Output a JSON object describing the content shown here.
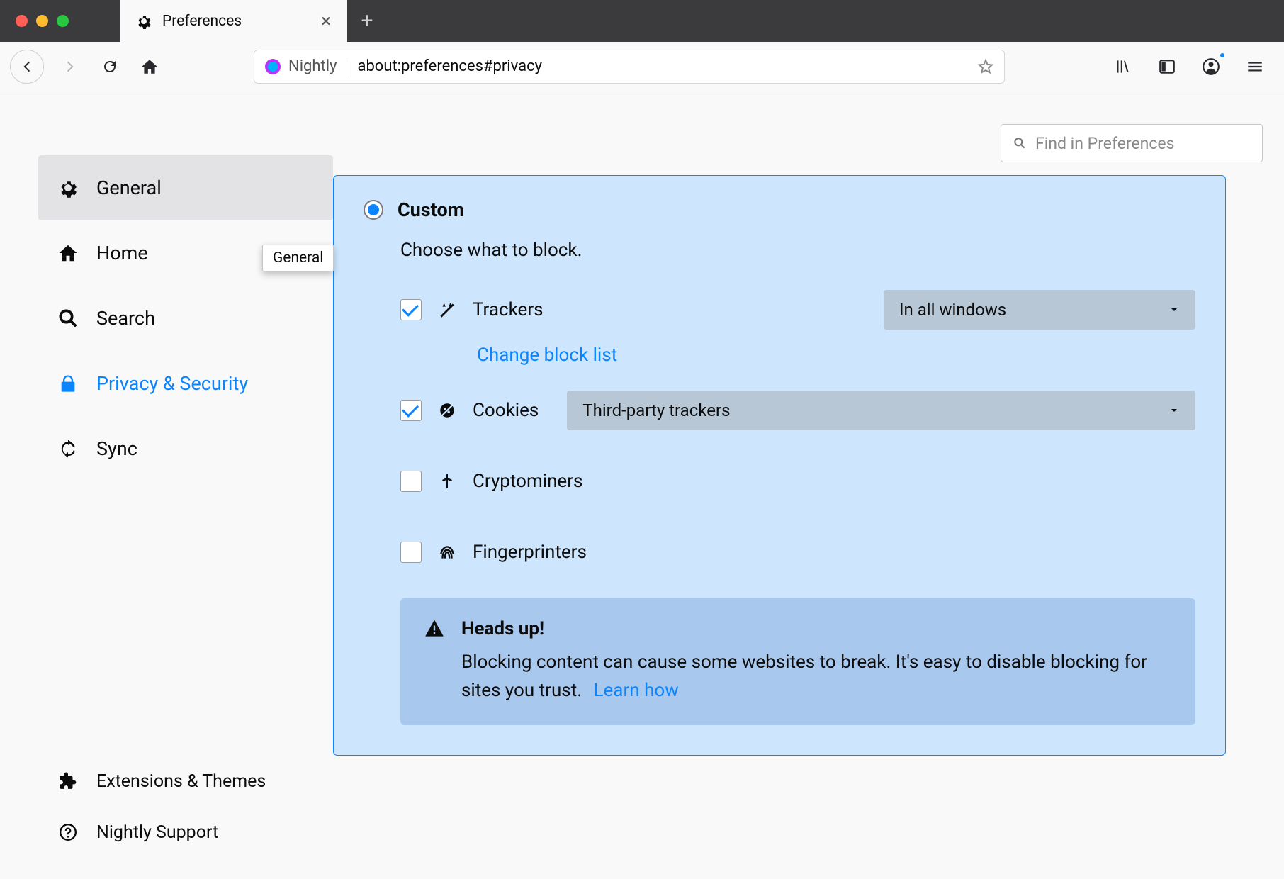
{
  "window": {
    "tab_title": "Preferences"
  },
  "urlbar": {
    "identity_label": "Nightly",
    "address": "about:preferences#privacy"
  },
  "find": {
    "placeholder": "Find in Preferences"
  },
  "sidebar": {
    "general": "General",
    "home": "Home",
    "search": "Search",
    "privacy": "Privacy & Security",
    "sync": "Sync",
    "extensions": "Extensions & Themes",
    "support": "Nightly Support",
    "tooltip_general": "General"
  },
  "panel": {
    "custom": "Custom",
    "choose": "Choose what to block.",
    "trackers": "Trackers",
    "trackers_select": "In all windows",
    "change_block_list": "Change block list",
    "cookies": "Cookies",
    "cookies_select": "Third-party trackers",
    "cryptominers": "Cryptominers",
    "fingerprinters": "Fingerprinters",
    "heads_up": "Heads up!",
    "heads_up_body": "Blocking content can cause some websites to break. It's easy to disable blocking for sites you trust.",
    "learn_how": "Learn how"
  }
}
